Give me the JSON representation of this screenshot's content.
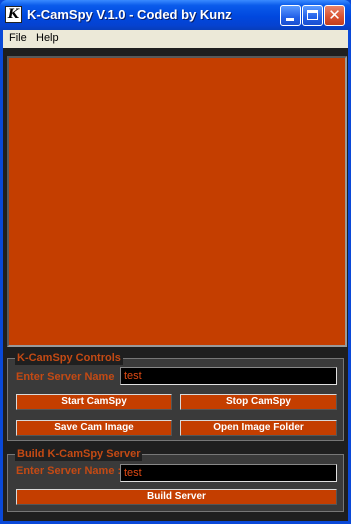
{
  "window": {
    "title": "K-CamSpy V.1.0 - Coded by Kunz",
    "app_icon_glyph": "K"
  },
  "menu": {
    "items": [
      "File",
      "Help"
    ]
  },
  "cam_view": {
    "color": "#C43E00"
  },
  "controls": {
    "legend": "K-CamSpy Controls",
    "server_label": "Enter Server Name",
    "server_value": "test",
    "start_button": "Start CamSpy",
    "stop_button": "Stop CamSpy",
    "save_button": "Save Cam Image",
    "open_folder_button": "Open Image Folder"
  },
  "build": {
    "legend": "Build K-CamSpy Server",
    "server_label": "Enter Server Name :",
    "server_value": "test",
    "build_button": "Build Server"
  },
  "colors": {
    "accent": "#C44A14",
    "button_bg": "#C43E00",
    "panel_bg": "#3A3A3A",
    "client_bg": "#1F1F1F",
    "titlebar": "#0048DF"
  }
}
